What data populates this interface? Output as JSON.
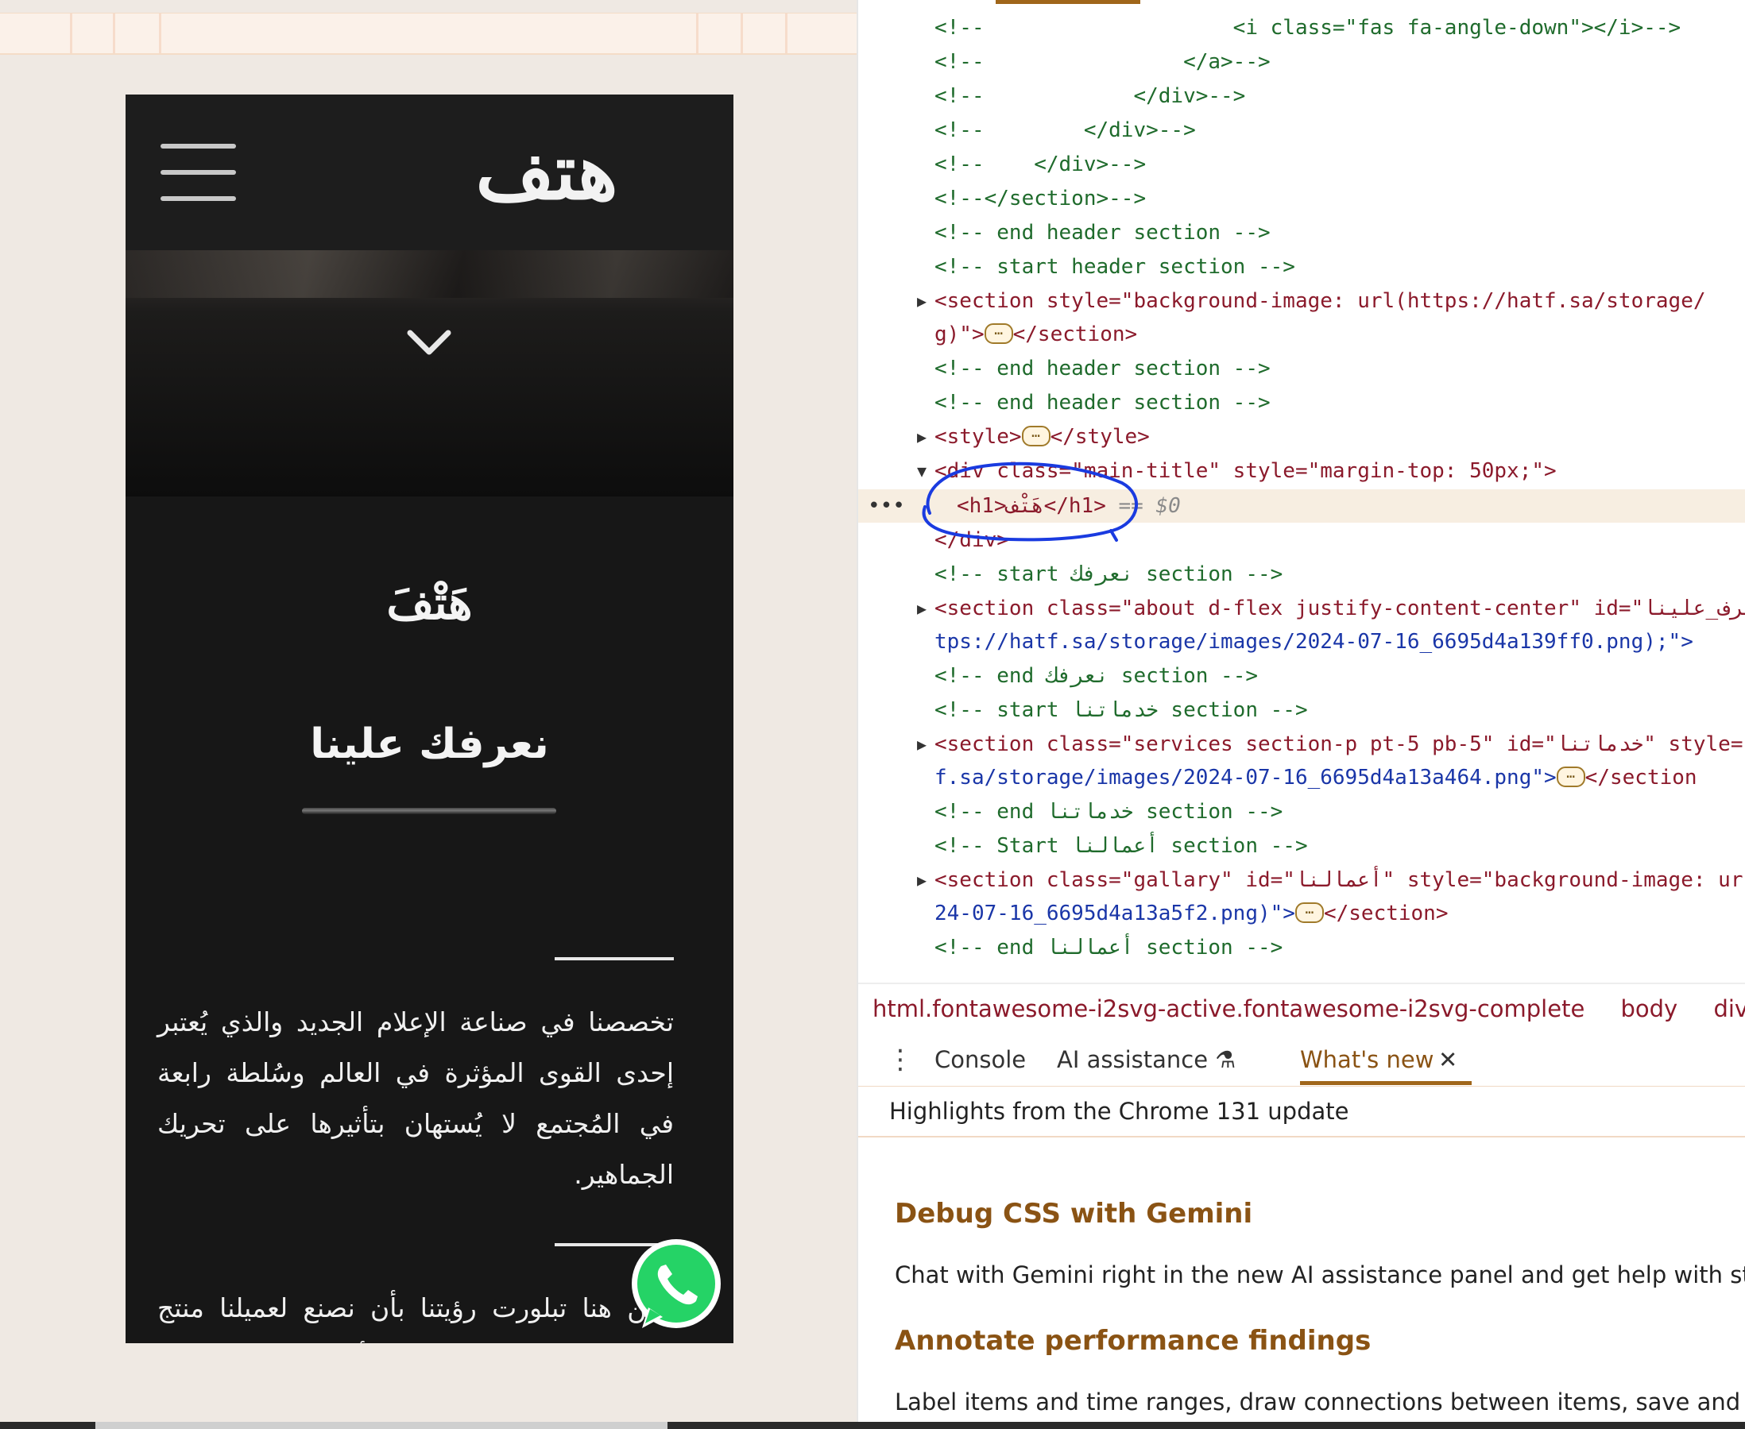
{
  "site": {
    "logo_text": "هتف",
    "main_title": "هَتْفَ",
    "about_heading": "نعرفك علينا",
    "paragraph_1": "تخصصنا في صناعة الإعلام الجديد والذي يُعتبر إحدى القوى المؤثرة في العالم وسُلطة رابعة في المُجتمع لا يُستهان بتأثيرها على تحريك الجماهير.",
    "paragraph_2": "ومن هنا تبلورت رؤيتنا بأن نصنع لعميلنا منتج إعلامي رصين قادر على التأثير في جمهوره و فئته المستهدفة و محققًا للأهداف التي وُضع لأجلها."
  },
  "elements": {
    "lines": [
      "<!--                    <i class=\"fas fa-angle-down\"></i>-->",
      "<!--                </a>-->",
      "<!--            </div>-->",
      "<!--        </div>-->",
      "<!--    </div>-->",
      "<!--</section>-->",
      "<!-- end header section -->",
      "<!-- start header section -->",
      "<section style=\"background-image: url(https://hatf.sa/storage/",
      "g)\">",
      "</section>",
      "<!-- end header section -->",
      "<!-- end header section -->",
      "<style>",
      "</style>",
      "<div class=\"main-title\" style=\"margin-top: 50px;\">",
      "<h1>هَتْف</h1>",
      "== $0",
      "</div>",
      "<!-- start نعرفك section -->",
      "<section class=\"about d-flex justify-content-center\" id=\"نعرف_علينا",
      "tps://hatf.sa/storage/images/2024-07-16_6695d4a139ff0.png);\">",
      "<!-- end نعرفك section -->",
      "<!-- start خدماتنا section -->",
      "<section class=\"services section-p pt-5 pb-5\" id=\"خدماتنا\" style=",
      "f.sa/storage/images/2024-07-16_6695d4a13a464.png\">",
      "</section",
      "<!-- end خدماتنا section -->",
      "<!-- Start أعمالنا section -->",
      "<section class=\"gallary\" id=\"أعمالنا\" style=\"background-image: ur",
      "24-07-16_6695d4a13a5f2.png)\">",
      "</section>",
      "<!-- end أعمالنا section -->"
    ],
    "row_dots": "•••"
  },
  "breadcrumb": {
    "items": [
      "html.fontawesome-i2svg-active.fontawesome-i2svg-complete",
      "body",
      "div.main-tit"
    ]
  },
  "drawer": {
    "tabs": [
      "Console",
      "AI assistance",
      "What's new"
    ],
    "close": "✕",
    "highlights": "Highlights from the Chrome 131 update",
    "items": [
      {
        "title": "Debug CSS with Gemini",
        "text": "Chat with Gemini right in the new AI assistance panel and get help with styling yo"
      },
      {
        "title": "Annotate performance findings",
        "text": "Label items and time ranges, draw connections between items, save and share an"
      }
    ]
  },
  "colors": {
    "accent": "#a0661a",
    "comment": "#1f6b2c",
    "tag": "#8b1a2b",
    "attr": "#b05606",
    "value": "#1a36a8",
    "annotation": "#1a3be0",
    "whatsapp": "#25d366"
  },
  "icons": [
    "hamburger-menu-icon",
    "chevron-down-icon",
    "whatsapp-icon",
    "expand-triangle-icon",
    "flask-icon",
    "close-icon",
    "kebab-menu-icon"
  ]
}
